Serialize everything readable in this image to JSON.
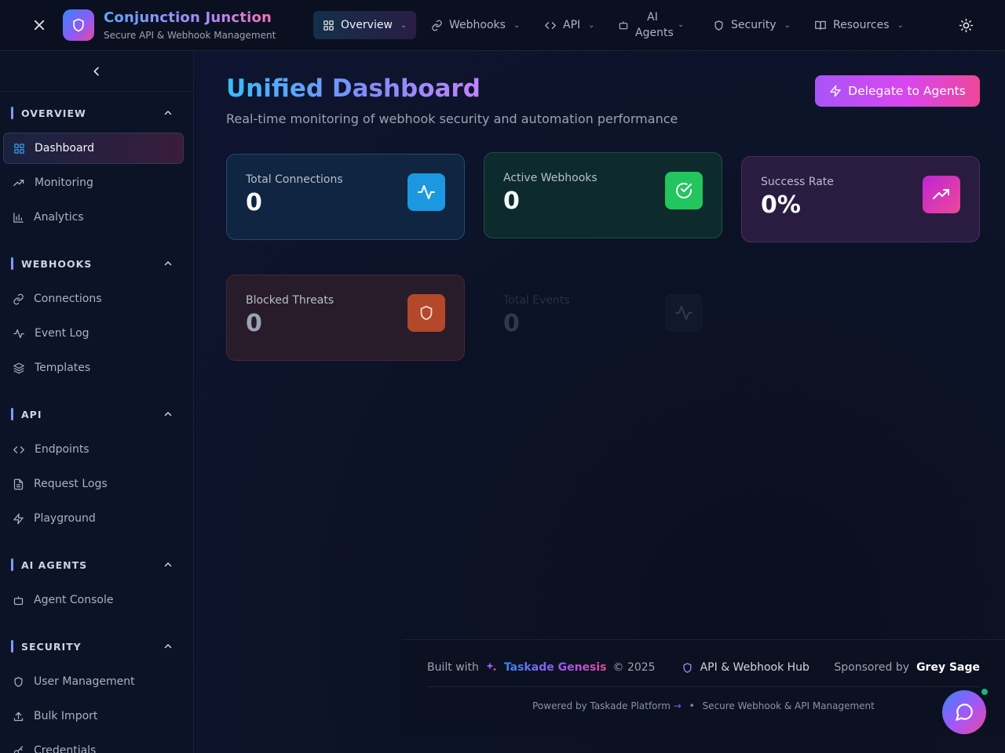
{
  "header": {
    "app_title": "Conjunction Junction",
    "app_subtitle": "Secure API & Webhook Management",
    "nav": [
      {
        "label": "Overview",
        "icon": "grid-icon",
        "active": true
      },
      {
        "label": "Webhooks",
        "icon": "link-icon",
        "active": false
      },
      {
        "label": "API",
        "icon": "code-icon",
        "active": false
      },
      {
        "label": "AI Agents",
        "icon": "bot-icon",
        "active": false
      },
      {
        "label": "Security",
        "icon": "shield-icon",
        "active": false
      },
      {
        "label": "Resources",
        "icon": "book-icon",
        "active": false
      }
    ]
  },
  "sidebar": {
    "sections": [
      {
        "title": "OVERVIEW",
        "items": [
          {
            "label": "Dashboard",
            "icon": "grid-icon",
            "active": true
          },
          {
            "label": "Monitoring",
            "icon": "trending-icon"
          },
          {
            "label": "Analytics",
            "icon": "bar-chart-icon"
          }
        ]
      },
      {
        "title": "WEBHOOKS",
        "items": [
          {
            "label": "Connections",
            "icon": "link-icon"
          },
          {
            "label": "Event Log",
            "icon": "activity-icon"
          },
          {
            "label": "Templates",
            "icon": "layers-icon"
          }
        ]
      },
      {
        "title": "API",
        "items": [
          {
            "label": "Endpoints",
            "icon": "code-icon"
          },
          {
            "label": "Request Logs",
            "icon": "file-icon"
          },
          {
            "label": "Playground",
            "icon": "zap-icon"
          }
        ]
      },
      {
        "title": "AI AGENTS",
        "items": [
          {
            "label": "Agent Console",
            "icon": "bot-icon"
          }
        ]
      },
      {
        "title": "SECURITY",
        "items": [
          {
            "label": "User Management",
            "icon": "shield-icon"
          },
          {
            "label": "Bulk Import",
            "icon": "upload-icon"
          },
          {
            "label": "Credentials",
            "icon": "key-icon"
          }
        ]
      }
    ]
  },
  "main": {
    "title": "Unified Dashboard",
    "subtitle": "Real-time monitoring of webhook security and automation performance",
    "delegate_label": "Delegate to Agents",
    "stats": [
      {
        "label": "Total Connections",
        "value": "0",
        "icon": "activity-icon",
        "color": "#1b98e0"
      },
      {
        "label": "Active Webhooks",
        "value": "0",
        "icon": "check-circle-icon",
        "color": "#22c55e"
      },
      {
        "label": "Success Rate",
        "value": "0%",
        "icon": "trending-up-icon",
        "color": "#d946ef"
      },
      {
        "label": "Blocked Threats",
        "value": "0",
        "icon": "shield-icon",
        "color": "#b4482b"
      },
      {
        "label": "Total Events",
        "value": "0",
        "icon": "activity-icon",
        "color": "#2a3a55"
      }
    ]
  },
  "footer": {
    "built_with": "Built with",
    "genesis": "Taskade Genesis",
    "year": "© 2025",
    "hub": "API & Webhook Hub",
    "sponsored_by": "Sponsored by",
    "sponsor": "Grey Sage",
    "powered": "Powered by Taskade Platform",
    "powered_arrow": "→",
    "bullet": "•",
    "tagline": "Secure Webhook & API Management"
  }
}
